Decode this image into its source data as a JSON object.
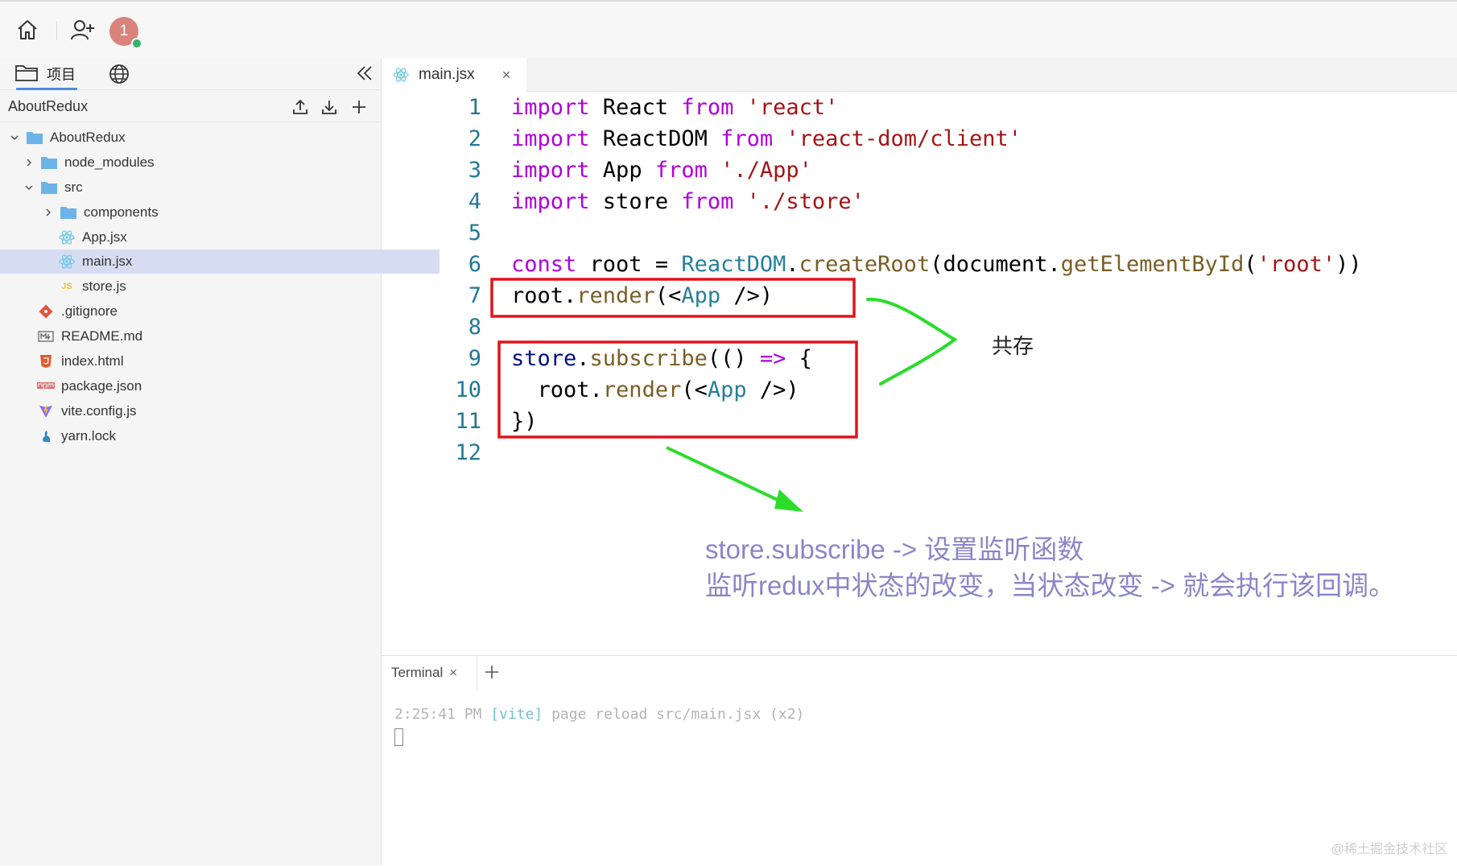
{
  "topbar": {
    "icons": [
      "home-icon",
      "add-user-icon"
    ],
    "avatar_text": "1"
  },
  "sidebar": {
    "tab_label": "项目",
    "project_name": "AboutRedux",
    "tree": [
      {
        "label": "AboutRedux",
        "icon": "folder-icon",
        "expanded": true,
        "depth": 0
      },
      {
        "label": "node_modules",
        "icon": "folder-icon",
        "expanded": false,
        "depth": 1
      },
      {
        "label": "src",
        "icon": "folder-icon",
        "expanded": true,
        "depth": 1
      },
      {
        "label": "components",
        "icon": "folder-icon",
        "expanded": false,
        "depth": 2
      },
      {
        "label": "App.jsx",
        "icon": "react-icon",
        "depth": 2
      },
      {
        "label": "main.jsx",
        "icon": "react-icon",
        "depth": 2,
        "selected": true
      },
      {
        "label": "store.js",
        "icon": "js-icon",
        "depth": 2
      },
      {
        "label": ".gitignore",
        "icon": "git-icon",
        "depth": 1
      },
      {
        "label": "README.md",
        "icon": "markdown-icon",
        "depth": 1
      },
      {
        "label": "index.html",
        "icon": "html-icon",
        "depth": 1
      },
      {
        "label": "package.json",
        "icon": "npm-icon",
        "depth": 1
      },
      {
        "label": "vite.config.js",
        "icon": "vite-icon",
        "depth": 1
      },
      {
        "label": "yarn.lock",
        "icon": "yarn-icon",
        "depth": 1
      }
    ]
  },
  "editor": {
    "tab_label": "main.jsx",
    "tab_close": "×",
    "lines": [
      {
        "n": "1",
        "tokens": [
          [
            "kw",
            "import"
          ],
          [
            "pl",
            " React "
          ],
          [
            "kw",
            "from"
          ],
          [
            "pl",
            " "
          ],
          [
            "str",
            "'react'"
          ]
        ]
      },
      {
        "n": "2",
        "tokens": [
          [
            "kw",
            "import"
          ],
          [
            "pl",
            " ReactDOM "
          ],
          [
            "kw",
            "from"
          ],
          [
            "pl",
            " "
          ],
          [
            "str",
            "'react-dom/client'"
          ]
        ]
      },
      {
        "n": "3",
        "tokens": [
          [
            "kw",
            "import"
          ],
          [
            "pl",
            " App "
          ],
          [
            "kw",
            "from"
          ],
          [
            "pl",
            " "
          ],
          [
            "str",
            "'./App'"
          ]
        ]
      },
      {
        "n": "4",
        "tokens": [
          [
            "kw",
            "import"
          ],
          [
            "pl",
            " store "
          ],
          [
            "kw",
            "from"
          ],
          [
            "pl",
            " "
          ],
          [
            "str",
            "'./store'"
          ]
        ]
      },
      {
        "n": "5",
        "tokens": []
      },
      {
        "n": "6",
        "tokens": [
          [
            "kw",
            "const"
          ],
          [
            "pl",
            " root = "
          ],
          [
            "ty",
            "ReactDOM"
          ],
          [
            "pl",
            "."
          ],
          [
            "fn",
            "createRoot"
          ],
          [
            "pl",
            "(document."
          ],
          [
            "fn",
            "getElementById"
          ],
          [
            "pl",
            "("
          ],
          [
            "str",
            "'root'"
          ],
          [
            "pl",
            "))"
          ]
        ]
      },
      {
        "n": "7",
        "tokens": [
          [
            "pl",
            "root."
          ],
          [
            "fn",
            "render"
          ],
          [
            "pl",
            "(<"
          ],
          [
            "tag",
            "App"
          ],
          [
            "pl",
            " />)"
          ]
        ]
      },
      {
        "n": "8",
        "tokens": []
      },
      {
        "n": "9",
        "tokens": [
          [
            "var",
            "store"
          ],
          [
            "pl",
            "."
          ],
          [
            "fn",
            "subscribe"
          ],
          [
            "pl",
            "(() "
          ],
          [
            "kw",
            "=>"
          ],
          [
            "pl",
            " {"
          ]
        ]
      },
      {
        "n": "10",
        "tokens": [
          [
            "pl",
            "  root."
          ],
          [
            "fn",
            "render"
          ],
          [
            "pl",
            "(<"
          ],
          [
            "tag",
            "App"
          ],
          [
            "pl",
            " />)"
          ]
        ]
      },
      {
        "n": "11",
        "tokens": [
          [
            "pl",
            "})"
          ]
        ]
      },
      {
        "n": "12",
        "tokens": []
      }
    ]
  },
  "annotations": {
    "shared_label": "共存",
    "note_line1": "store.subscribe -> 设置监听函数",
    "note_line2": "监听redux中状态的改变，当状态改变 -> 就会执行该回调。",
    "box_color": "#e0141b",
    "arrow_color": "#2bdc2b"
  },
  "terminal": {
    "tab_label": "Terminal",
    "tab_close": "×",
    "output_time": "2:25:41 PM",
    "output_tag": "[vite]",
    "output_msg": "page reload src/main.jsx (x2)"
  },
  "watermark": "@稀土掘金技术社区"
}
